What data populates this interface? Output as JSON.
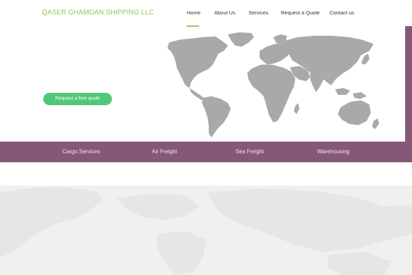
{
  "header": {
    "logo_text": "QASER GHAMDAN SHIPPING LLC",
    "nav": [
      {
        "label": "Home",
        "active": true
      },
      {
        "label": "About Us"
      },
      {
        "label": "Services"
      },
      {
        "label": "Request a Quote"
      },
      {
        "label": "Contact us"
      }
    ]
  },
  "hero": {
    "cta_label": "Request a free quote"
  },
  "services_band": {
    "items": [
      "Cargo Services",
      "Air Freight",
      "Sea Freight",
      "Warehousing"
    ]
  },
  "colors": {
    "logo": "#8cc85a",
    "nav_active": "#8cc85a",
    "cta": "#4fc878",
    "band": "#855878",
    "map": "#a9a9a9",
    "section_bg": "#f0f0f0"
  }
}
